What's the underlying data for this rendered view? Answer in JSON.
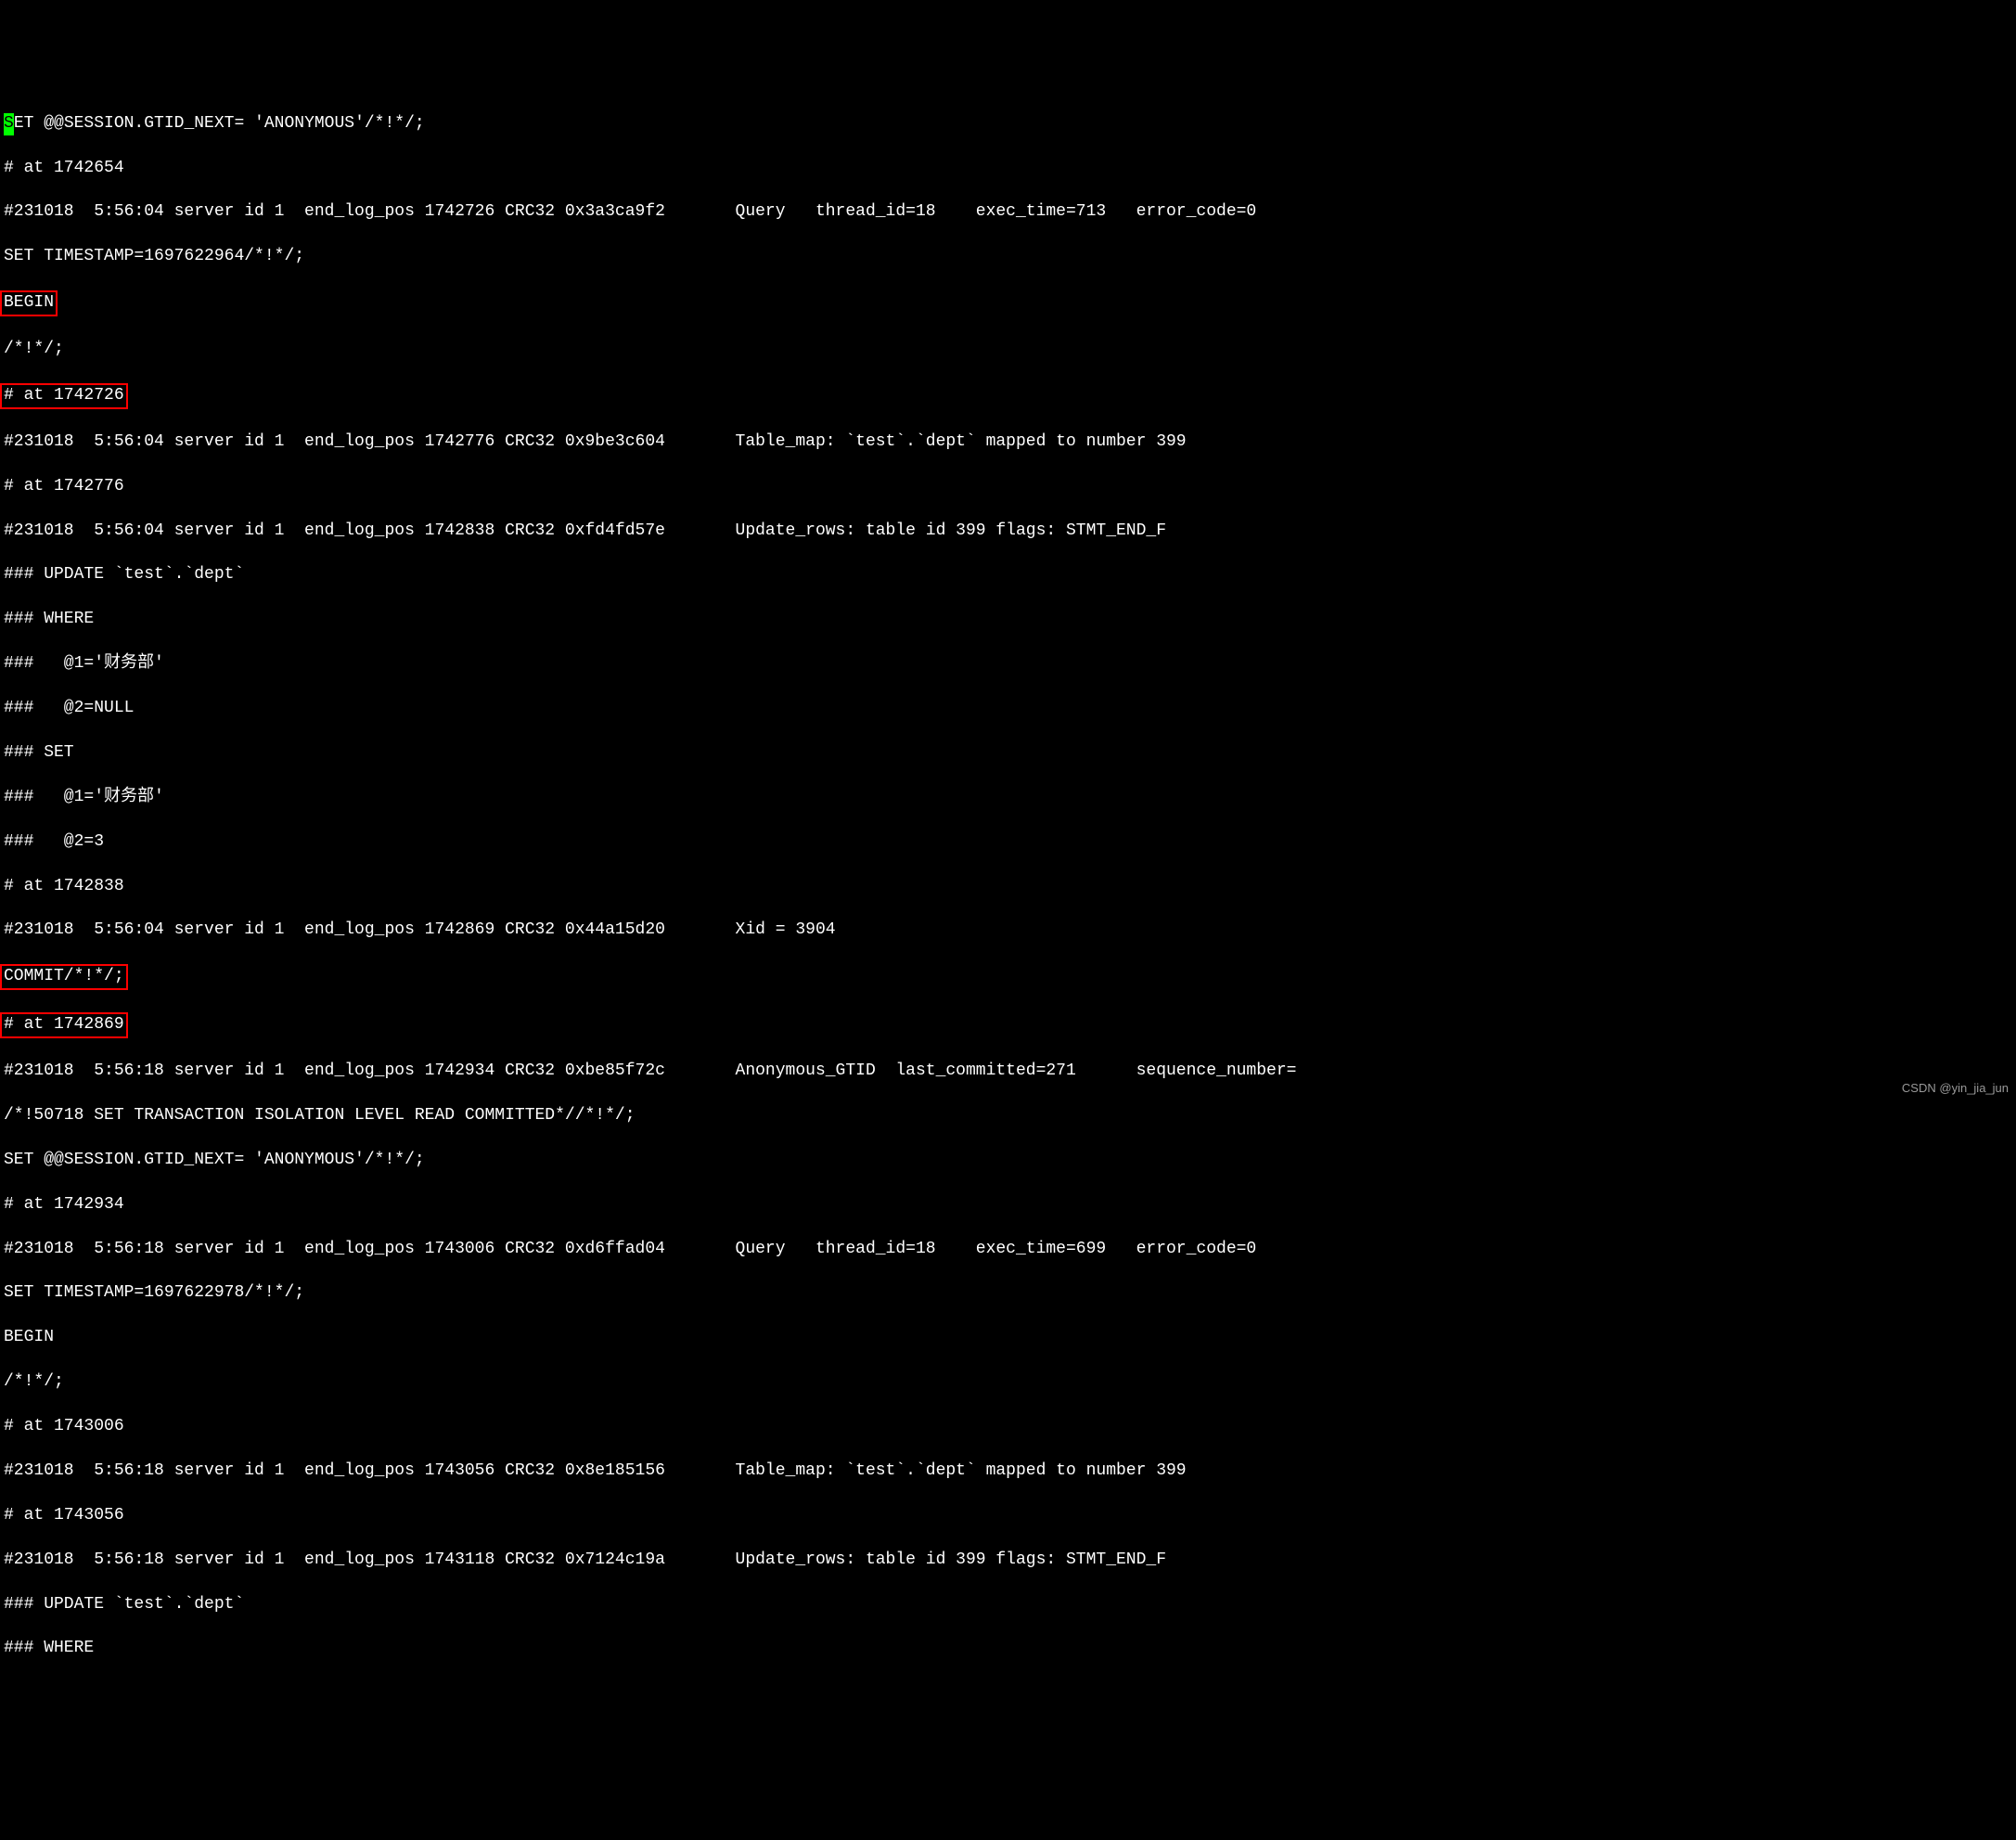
{
  "line01_a": "S",
  "line01_b": "ET @@SESSION.GTID_NEXT= 'ANONYMOUS'/*!*/;",
  "line02": "# at 1742654",
  "line03": "#231018  5:56:04 server id 1  end_log_pos 1742726 CRC32 0x3a3ca9f2       Query   thread_id=18    exec_time=713   error_code=0",
  "line04": "SET TIMESTAMP=1697622964/*!*/;",
  "line05": "BEGIN",
  "line06": "/*!*/;",
  "line07": "# at 1742726",
  "line08": "#231018  5:56:04 server id 1  end_log_pos 1742776 CRC32 0x9be3c604       Table_map: `test`.`dept` mapped to number 399",
  "line09": "# at 1742776",
  "line10": "#231018  5:56:04 server id 1  end_log_pos 1742838 CRC32 0xfd4fd57e       Update_rows: table id 399 flags: STMT_END_F",
  "line11": "### UPDATE `test`.`dept`",
  "line12": "### WHERE",
  "line13": "###   @1='财务部'",
  "line14": "###   @2=NULL",
  "line15": "### SET",
  "line16": "###   @1='财务部'",
  "line17": "###   @2=3",
  "line18": "# at 1742838",
  "line19": "#231018  5:56:04 server id 1  end_log_pos 1742869 CRC32 0x44a15d20       Xid = 3904",
  "line20": "COMMIT/*!*/;",
  "line21": "# at 1742869",
  "line22": "#231018  5:56:18 server id 1  end_log_pos 1742934 CRC32 0xbe85f72c       Anonymous_GTID  last_committed=271      sequence_number=",
  "line23": "/*!50718 SET TRANSACTION ISOLATION LEVEL READ COMMITTED*//*!*/;",
  "line24": "SET @@SESSION.GTID_NEXT= 'ANONYMOUS'/*!*/;",
  "line25": "# at 1742934",
  "line26": "#231018  5:56:18 server id 1  end_log_pos 1743006 CRC32 0xd6ffad04       Query   thread_id=18    exec_time=699   error_code=0",
  "line27": "SET TIMESTAMP=1697622978/*!*/;",
  "line28": "BEGIN",
  "line29": "/*!*/;",
  "line30": "# at 1743006",
  "line31": "#231018  5:56:18 server id 1  end_log_pos 1743056 CRC32 0x8e185156       Table_map: `test`.`dept` mapped to number 399",
  "line32": "# at 1743056",
  "line33": "#231018  5:56:18 server id 1  end_log_pos 1743118 CRC32 0x7124c19a       Update_rows: table id 399 flags: STMT_END_F",
  "line34": "### UPDATE `test`.`dept`",
  "line35": "### WHERE",
  "watermark": "CSDN @yin_jia_jun"
}
